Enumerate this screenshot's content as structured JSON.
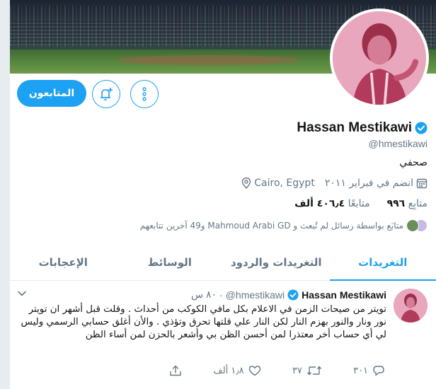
{
  "profile": {
    "display_name": "Hassan Mestikawi",
    "handle": "@hmestikawi",
    "bio": "صحفي",
    "location": "Cairo, Egypt",
    "joined": "انضم في فبراير ٢٠١١",
    "verified": true
  },
  "stats": {
    "following_count": "٩٩٦",
    "following_label": "متابِع",
    "followers_count": "٤٠٦٫٤ ألف",
    "followers_label": "متابعًا"
  },
  "followers_you_know": "متابَع بواسطة رسائل لم تُبعث و Mahmoud Arabi GD و49 آخرين تتابعهم",
  "buttons": {
    "following_label": "المتابعون",
    "more_icon": "more-vertical-icon",
    "notify_icon": "bell-plus-icon"
  },
  "tabs": [
    {
      "label": "التغريدات",
      "active": true
    },
    {
      "label": "التغريدات والردود",
      "active": false
    },
    {
      "label": "الوسائط",
      "active": false
    },
    {
      "label": "الإعجابات",
      "active": false
    }
  ],
  "tweet": {
    "name": "Hassan Mestikawi",
    "handle": "@hmestikawi",
    "time": "٨٠ س",
    "text": "تويتر من صيحات الزمن في الاعلام بكل مافي الكوكب من أحداث . وقلت قبل أشهر ان تويتر نور ونار والنور بهزم النار لكن النار علي قلتها تحرق وتؤذي  . والأن أغلق حسابي الرسمي وليس لي أي حساب أخر معتذرا لمن أحسن الظن بي وأشعر بالحزن لمن أساء الظن",
    "replies": "٣٠١",
    "retweets": "٣٧",
    "likes": "١٫٨ ألف"
  },
  "colors": {
    "accent": "#1da1f2",
    "text": "#14171a",
    "muted": "#657786"
  }
}
